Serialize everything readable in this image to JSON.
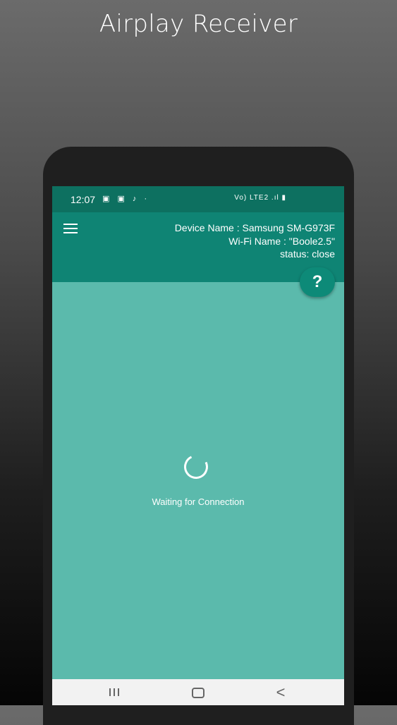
{
  "promo": {
    "title": "Airplay Receiver"
  },
  "statusbar": {
    "time": "12:07",
    "left_icons": "▣ ▣ ♪ ·",
    "right_icons": "Vo) LTE2 .ıl ▮"
  },
  "appbar": {
    "device_name": "Device Name : Samsung SM-G973F",
    "wifi_name": "Wi-Fi Name : \"Boole2.5\"",
    "status": "status: close"
  },
  "help": {
    "label": "?"
  },
  "main": {
    "waiting_text": "Waiting for Connection"
  },
  "navbar": {
    "back_label": "<"
  },
  "colors": {
    "appbar": "#0f8474",
    "statusbar": "#0d7060",
    "content": "#5bbaac",
    "fab": "#0d8a78"
  }
}
